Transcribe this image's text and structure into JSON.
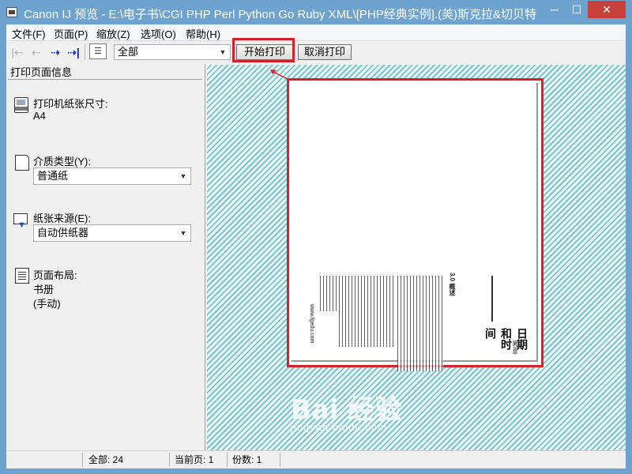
{
  "window": {
    "title": "Canon IJ 预览 - E:\\电子书\\CGI PHP Perl Python Go Ruby XML\\[PHP经典实例].(美)斯克拉&切贝特...",
    "minimize_label": "─",
    "maximize_label": "☐",
    "close_label": "✕"
  },
  "menubar": {
    "items": [
      "文件(F)",
      "页面(P)",
      "缩放(Z)",
      "选项(O)",
      "帮助(H)"
    ]
  },
  "toolbar": {
    "nav_icons": [
      "first-page-icon",
      "previous-page-icon",
      "next-page-icon",
      "last-page-icon"
    ],
    "page_select_value": "全部",
    "start_print_label": "开始打印",
    "cancel_print_label": "取消打印"
  },
  "left_panel": {
    "header": "打印页面信息",
    "paper_size": {
      "label": "打印机纸张尺寸:",
      "value": "A4",
      "icon": "printer-paper-icon"
    },
    "media_type": {
      "label": "介质类型(Y):",
      "value": "普通纸",
      "icon": "media-page-icon"
    },
    "paper_source": {
      "label": "纸张来源(E):",
      "value": "自动供纸器",
      "icon": "paper-source-icon"
    },
    "page_layout": {
      "label": "页面布局:",
      "value_line1": "书册",
      "value_line2": "(手动)",
      "icon": "page-layout-icon"
    }
  },
  "preview": {
    "chapter_title": "日期和时间",
    "chapter_number": "第3章",
    "section_heading": "3.0  概述",
    "footer_url": "www.fgedu.com"
  },
  "watermark": {
    "main": "Bai 经验",
    "sub": "jingyan.baidu.com"
  },
  "status": {
    "total": "全部:  24",
    "current_page": "当前页:  1",
    "copies": "份数:  1"
  },
  "colors": {
    "titlebar": "#6fa3cf",
    "highlight_red": "#d6232b",
    "close_button": "#c7413a"
  }
}
